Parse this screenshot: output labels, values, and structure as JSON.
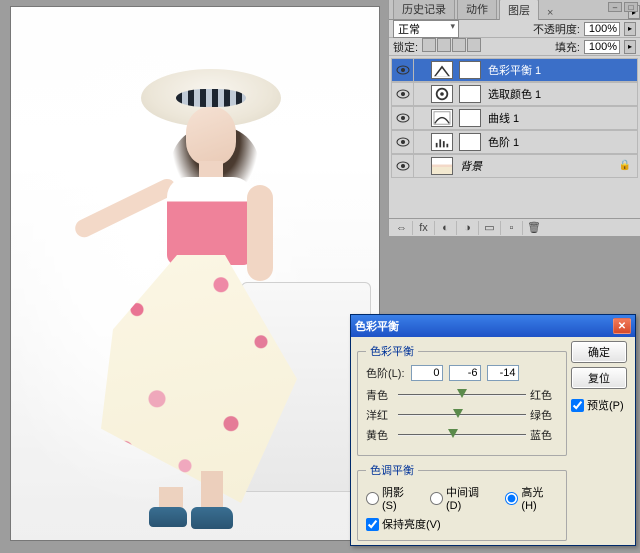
{
  "panel": {
    "tabs": {
      "history": "历史记录",
      "actions": "动作",
      "layers": "图层"
    },
    "blend_mode": "正常",
    "opacity_label": "不透明度:",
    "opacity_value": "100%",
    "lock_label": "锁定:",
    "fill_label": "填充:",
    "fill_value": "100%",
    "layers": {
      "l0": "色彩平衡 1",
      "l1": "选取颜色 1",
      "l2": "曲线 1",
      "l3": "色阶 1",
      "bg": "背景"
    }
  },
  "dialog": {
    "title": "色彩平衡",
    "group_balance": "色彩平衡",
    "levels_label": "色阶(L):",
    "levels": {
      "a": "0",
      "b": "-6",
      "c": "-14"
    },
    "axes": {
      "cyan": "青色",
      "red": "红色",
      "magenta": "洋红",
      "green": "绿色",
      "yellow": "黄色",
      "blue": "蓝色"
    },
    "group_tone": "色调平衡",
    "tone": {
      "shadows": "阴影(S)",
      "midtones": "中间调(D)",
      "highlights": "高光(H)"
    },
    "preserve": "保持亮度(V)",
    "buttons": {
      "ok": "确定",
      "reset": "复位",
      "preview": "预览(P)"
    }
  }
}
